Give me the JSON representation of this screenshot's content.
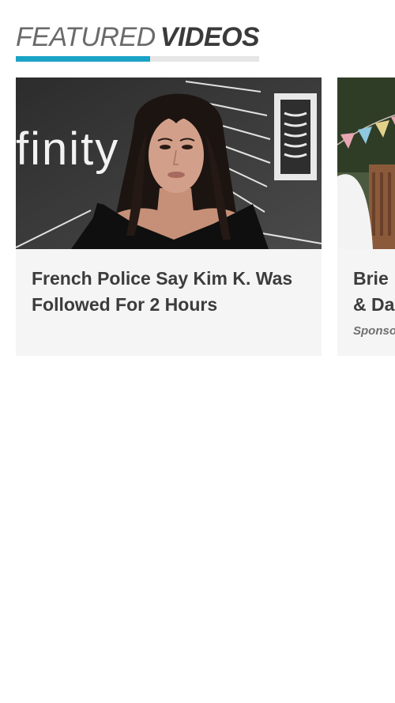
{
  "section": {
    "title_light": "FEATURED",
    "title_bold": "VIDEOS"
  },
  "cards": [
    {
      "title": "French Police Say Kim K. Was Followed For 2 Hours",
      "backdrop_text": "finity"
    },
    {
      "title": "Brie\n& Da",
      "sponsor": "Sponsor"
    }
  ],
  "colors": {
    "accent": "#1ba3c6",
    "card_background": "#f5f5f5",
    "title_text": "#3c3c3c"
  }
}
